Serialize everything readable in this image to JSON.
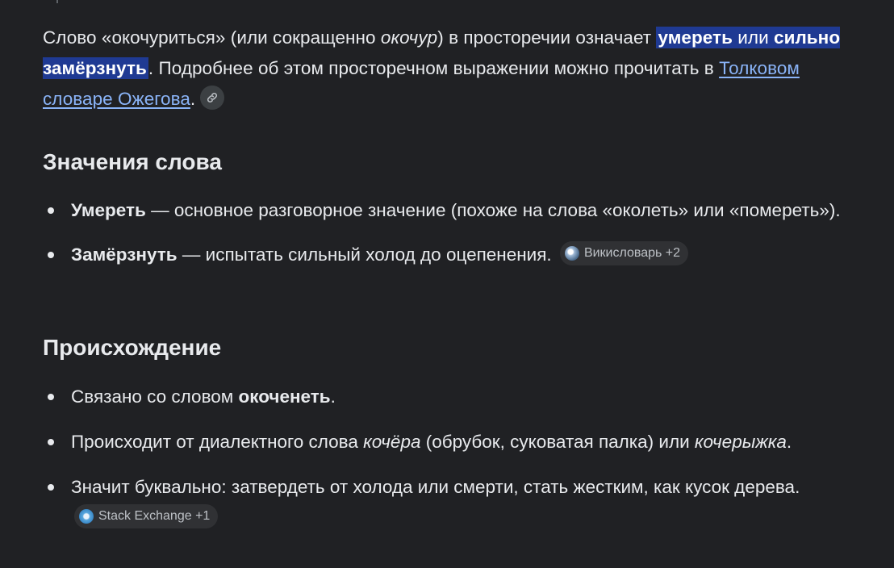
{
  "intro": {
    "t1": "Слово «окочуриться» (или сокращенно ",
    "t2": "окочур",
    "t3": ") в просторечии означает ",
    "hl_bold": "умереть",
    "hl_mid": " или ",
    "hl_bold2": "сильно замёрзнуть",
    "t4": ". Подробнее об этом просторечном выражении можно прочитать в ",
    "link": "Толковом словаре Ожегова",
    "t5": "."
  },
  "meanings": {
    "heading": "Значения слова",
    "items": [
      {
        "term": "Умереть",
        "text": " — основное разговорное значение (похоже на слова «околеть» или «помереть»)."
      },
      {
        "term": "Замёрзнуть",
        "text": " — испытать сильный холод до оцепенения.",
        "chip": "Викисловарь +2"
      }
    ]
  },
  "origin": {
    "heading": "Происхождение",
    "item1": {
      "text": "Связано со словом ",
      "term": "окоченеть",
      "end": "."
    },
    "item2": {
      "text": "Происходит от диалектного слова ",
      "it1": "кочёра",
      "mid": " (обрубок, суковатая палка) или ",
      "it2": "кочерыжка",
      "end": "."
    },
    "item3": {
      "text": "Значит буквально: затвердеть от холода или смерти, стать жестким, как кусок дерева.",
      "chip": "Stack Exchange +1"
    }
  }
}
